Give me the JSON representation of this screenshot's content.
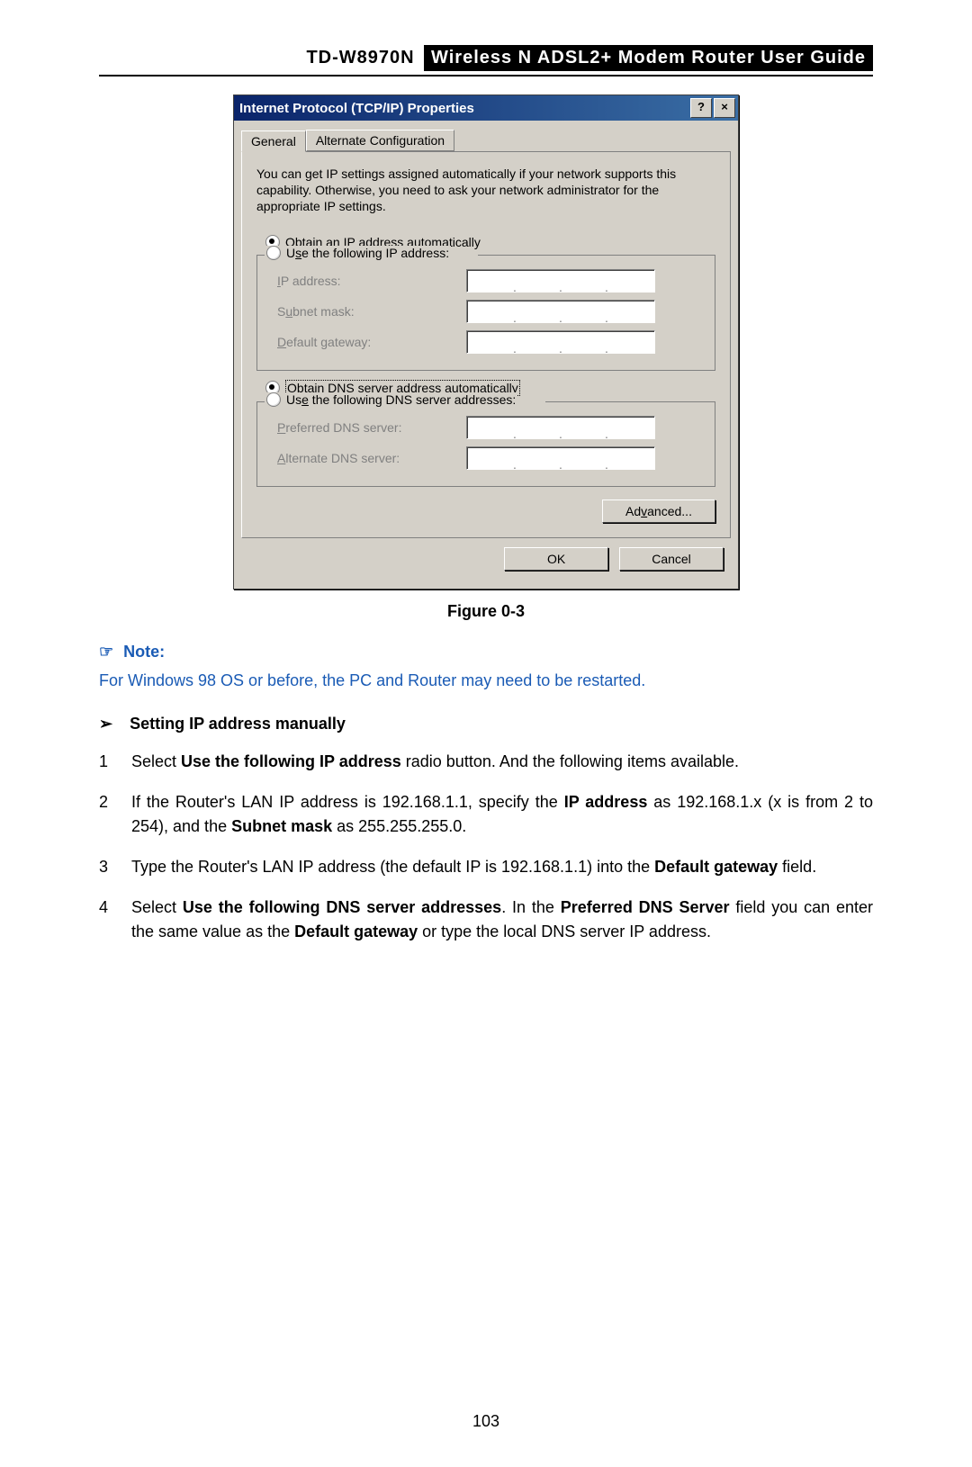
{
  "header": {
    "model": "TD-W8970N",
    "guide_title": "Wireless  N  ADSL2+  Modem  Router  User  Guide"
  },
  "dialog": {
    "title": "Internet Protocol (TCP/IP) Properties",
    "help_btn": "?",
    "close_btn": "×",
    "tabs": {
      "general": "General",
      "alt": "Alternate Configuration"
    },
    "description": "You can get IP settings assigned automatically if your network supports this capability. Otherwise, you need to ask your network administrator for the appropriate IP settings.",
    "radios": {
      "obtain_ip": "Obtain an IP address automatically",
      "use_ip": "Use the following IP address:",
      "obtain_dns": "Obtain DNS server address automatically",
      "use_dns": "Use the following DNS server addresses:"
    },
    "fields": {
      "ip_address": "IP address:",
      "subnet_mask": "Subnet mask:",
      "default_gateway": "Default gateway:",
      "preferred_dns": "Preferred DNS server:",
      "alternate_dns": "Alternate DNS server:"
    },
    "buttons": {
      "advanced": "Advanced...",
      "ok": "OK",
      "cancel": "Cancel"
    }
  },
  "figure_caption": "Figure 0-3",
  "note": {
    "icon": "☞",
    "label": "Note:",
    "body": "For Windows 98 OS or before, the PC and Router may need to be restarted."
  },
  "section": {
    "arrow": "➢",
    "title": "Setting IP address manually"
  },
  "steps": {
    "s1a": "Select ",
    "s1b": "Use the following IP address",
    "s1c": " radio button. And the following items available.",
    "s2a": "If the Router's LAN IP address is 192.168.1.1, specify the ",
    "s2b": "IP address",
    "s2c": " as 192.168.1.x (x is from 2 to 254), and the ",
    "s2d": "Subnet mask",
    "s2e": " as 255.255.255.0.",
    "s3a": "Type the Router's LAN IP address (the default IP is 192.168.1.1) into the ",
    "s3b": "Default gateway",
    "s3c": " field.",
    "s4a": "Select ",
    "s4b": "Use the following DNS server addresses",
    "s4c": ".  In the ",
    "s4d": "Preferred DNS Server",
    "s4e": " field you can enter the same value as the ",
    "s4f": "Default gateway",
    "s4g": " or type the local DNS server IP address."
  },
  "page_number": "103"
}
